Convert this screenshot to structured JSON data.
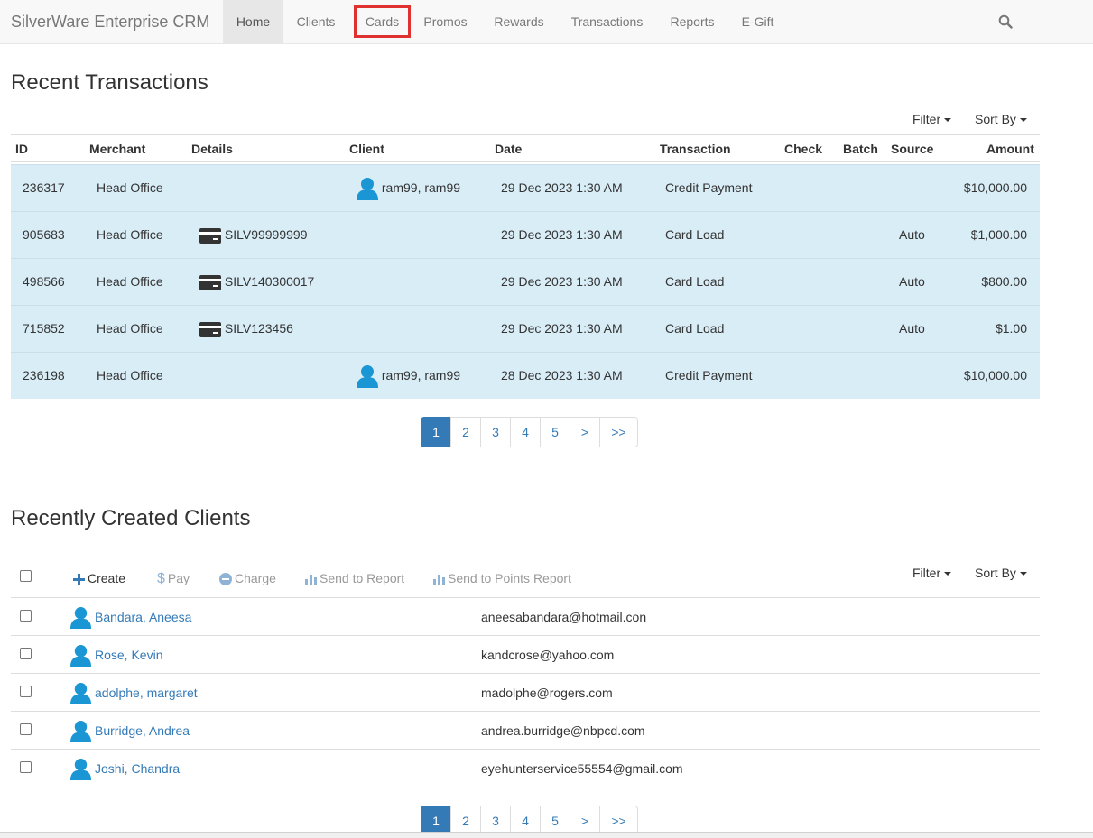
{
  "app": {
    "brand": "SilverWare Enterprise CRM"
  },
  "nav": {
    "items": [
      {
        "label": "Home"
      },
      {
        "label": "Clients"
      },
      {
        "label": "Cards"
      },
      {
        "label": "Promos"
      },
      {
        "label": "Rewards"
      },
      {
        "label": "Transactions"
      },
      {
        "label": "Reports"
      },
      {
        "label": "E-Gift"
      }
    ],
    "active": "Home",
    "highlighted": "Cards",
    "search_icon": "search-icon"
  },
  "colors": {
    "row_highlight": "#d9edf7",
    "link": "#337ab7",
    "highlight_box": "#e03131",
    "icon_blue": "#1a96d4"
  },
  "transactions": {
    "title": "Recent Transactions",
    "filter_label": "Filter",
    "sort_label": "Sort By",
    "columns": {
      "id": "ID",
      "merchant": "Merchant",
      "details": "Details",
      "client": "Client",
      "date": "Date",
      "transaction": "Transaction",
      "check": "Check",
      "batch": "Batch",
      "source": "Source",
      "amount": "Amount"
    },
    "rows": [
      {
        "id": "236317",
        "merchant": "Head Office",
        "details": "",
        "client": "ram99, ram99",
        "date": "29 Dec 2023 1:30 AM",
        "transaction": "Credit Payment",
        "source": "",
        "amount": "$10,000.00"
      },
      {
        "id": "905683",
        "merchant": "Head Office",
        "details": "SILV99999999",
        "client": "",
        "date": "29 Dec 2023 1:30 AM",
        "transaction": "Card Load",
        "source": "Auto",
        "amount": "$1,000.00"
      },
      {
        "id": "498566",
        "merchant": "Head Office",
        "details": "SILV140300017",
        "client": "",
        "date": "29 Dec 2023 1:30 AM",
        "transaction": "Card Load",
        "source": "Auto",
        "amount": "$800.00"
      },
      {
        "id": "715852",
        "merchant": "Head Office",
        "details": "SILV123456",
        "client": "",
        "date": "29 Dec 2023 1:30 AM",
        "transaction": "Card Load",
        "source": "Auto",
        "amount": "$1.00"
      },
      {
        "id": "236198",
        "merchant": "Head Office",
        "details": "",
        "client": "ram99, ram99",
        "date": "28 Dec 2023 1:30 AM",
        "transaction": "Credit Payment",
        "source": "",
        "amount": "$10,000.00"
      }
    ],
    "pagination": {
      "pages": [
        "1",
        "2",
        "3",
        "4",
        "5"
      ],
      "next": ">",
      "last": ">>",
      "current": "1"
    }
  },
  "clients": {
    "title": "Recently Created Clients",
    "filter_label": "Filter",
    "sort_label": "Sort By",
    "toolbar": {
      "create": "Create",
      "pay": "Pay",
      "charge": "Charge",
      "send_to_report": "Send to Report",
      "send_to_points_report": "Send to Points Report"
    },
    "rows": [
      {
        "name": "Bandara, Aneesa",
        "email": "aneesabandara@hotmail.con"
      },
      {
        "name": "Rose, Kevin",
        "email": "kandcrose@yahoo.com"
      },
      {
        "name": "adolphe, margaret",
        "email": "madolphe@rogers.com"
      },
      {
        "name": "Burridge, Andrea",
        "email": "andrea.burridge@nbpcd.com"
      },
      {
        "name": "Joshi, Chandra",
        "email": "eyehunterservice55554@gmail.com"
      }
    ],
    "pagination": {
      "pages": [
        "1",
        "2",
        "3",
        "4",
        "5"
      ],
      "next": ">",
      "last": ">>",
      "current": "1"
    }
  }
}
